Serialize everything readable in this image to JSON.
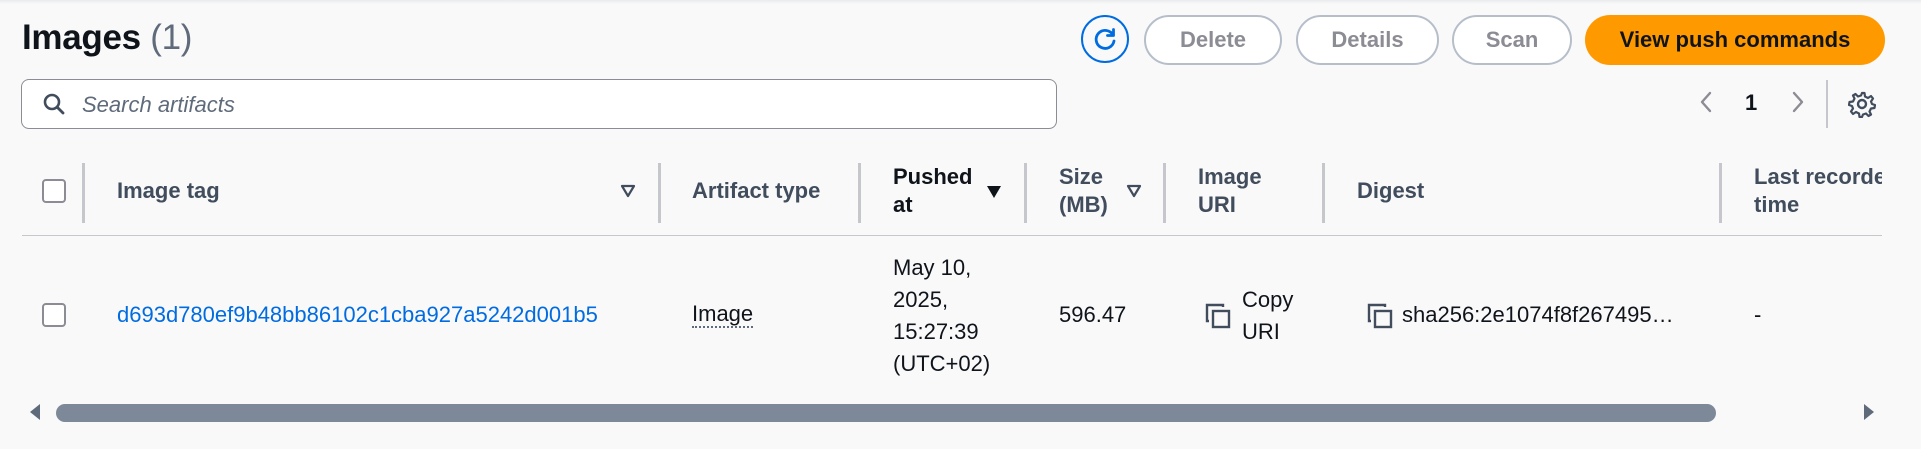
{
  "header": {
    "title": "Images",
    "count": "(1)",
    "refresh_icon": "refresh-icon",
    "buttons": {
      "delete": "Delete",
      "details": "Details",
      "scan": "Scan",
      "view_push": "View push commands"
    }
  },
  "search": {
    "placeholder": "Search artifacts",
    "value": ""
  },
  "pagination": {
    "current_page": "1"
  },
  "table": {
    "columns": {
      "image_tag": "Image tag",
      "artifact_type": "Artifact type",
      "pushed_at_1": "Pushed",
      "pushed_at_2": "at",
      "size_1": "Size",
      "size_2": "(MB)",
      "uri_1": "Image",
      "uri_2": "URI",
      "digest": "Digest",
      "last_recorded_1": "Last recorded",
      "last_recorded_2": "time"
    },
    "rows": [
      {
        "image_tag": "d693d780ef9b48bb86102c1cba927a5242d001b5",
        "artifact_type": "Image",
        "pushed_at_lines": [
          "May 10,",
          "2025,",
          "15:27:39",
          "(UTC+02)"
        ],
        "size": "596.47",
        "copy_uri_1": "Copy",
        "copy_uri_2": "URI",
        "digest": "sha256:2e1074f8f267495…",
        "last_recorded": "-"
      }
    ]
  },
  "colors": {
    "accent": "#006ce0",
    "primary": "#ff9900",
    "text": "#0f141a"
  }
}
